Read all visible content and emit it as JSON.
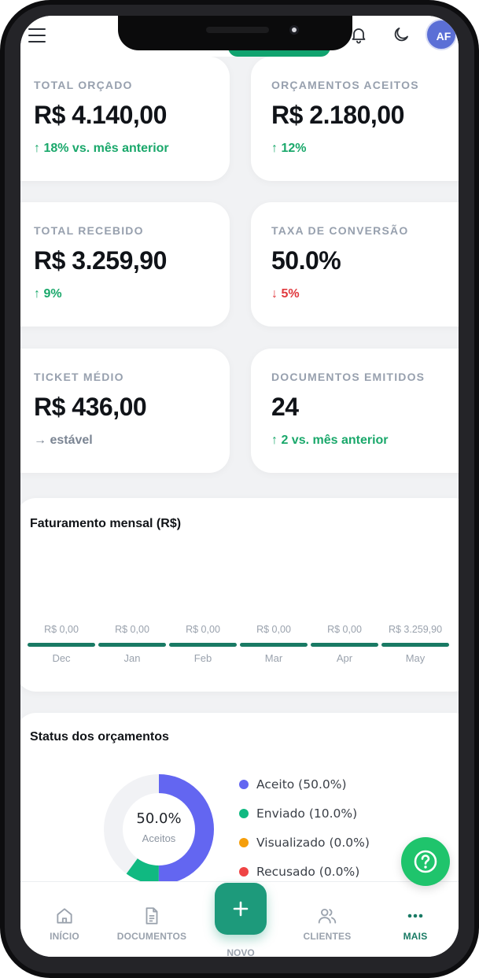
{
  "topbar": {
    "avatar_initials": "AF"
  },
  "stats": [
    {
      "label": "TOTAL ORÇADO",
      "value": "R$ 4.140,00",
      "delta": "↑ 18% vs. mês anterior",
      "trend": "up"
    },
    {
      "label": "ORÇAMENTOS ACEITOS",
      "value": "R$ 2.180,00",
      "delta": "↑ 12%",
      "trend": "up"
    },
    {
      "label": "TOTAL RECEBIDO",
      "value": "R$ 3.259,90",
      "delta": "↑ 9%",
      "trend": "up"
    },
    {
      "label": "TAXA DE CONVERSÃO",
      "value": "50.0%",
      "delta": "↓ 5%",
      "trend": "down"
    },
    {
      "label": "TICKET MÉDIO",
      "value": "R$ 436,00",
      "delta": "→ estável",
      "trend": "flat"
    },
    {
      "label": "DOCUMENTOS EMITIDOS",
      "value": "24",
      "delta": "↑ 2 vs. mês anterior",
      "trend": "up"
    }
  ],
  "revenue": {
    "title": "Faturamento mensal (R$)",
    "months": [
      {
        "label": "Dec",
        "value_text": "R$ 0,00"
      },
      {
        "label": "Jan",
        "value_text": "R$ 0,00"
      },
      {
        "label": "Feb",
        "value_text": "R$ 0,00"
      },
      {
        "label": "Mar",
        "value_text": "R$ 0,00"
      },
      {
        "label": "Apr",
        "value_text": "R$ 0,00"
      },
      {
        "label": "May",
        "value_text": "R$ 3.259,90"
      }
    ]
  },
  "chart_data": [
    {
      "type": "bar",
      "title": "Faturamento mensal (R$)",
      "categories": [
        "Dec",
        "Jan",
        "Feb",
        "Mar",
        "Apr",
        "May"
      ],
      "values": [
        0,
        0,
        0,
        0,
        0,
        3259.9
      ]
    },
    {
      "type": "pie",
      "title": "Status dos orçamentos",
      "categories": [
        "Aceito",
        "Enviado",
        "Visualizado",
        "Recusado"
      ],
      "values": [
        50.0,
        10.0,
        0.0,
        0.0
      ]
    }
  ],
  "status": {
    "title": "Status dos orçamentos",
    "center_value": "50.0%",
    "center_label": "Aceitos",
    "legend": [
      {
        "label": "Aceito (50.0%)",
        "color": "#6366f1"
      },
      {
        "label": "Enviado (10.0%)",
        "color": "#10b981"
      },
      {
        "label": "Visualizado (0.0%)",
        "color": "#f59e0b"
      },
      {
        "label": "Recusado (0.0%)",
        "color": "#ef4444"
      }
    ]
  },
  "nav": {
    "inicio": "INÍCIO",
    "documentos": "DOCUMENTOS",
    "novo": "NOVO",
    "clientes": "CLIENTES",
    "mais": "MAIS",
    "active_color": "#197a64"
  },
  "icons": {
    "menu": "hamburger-menu-icon",
    "notifications": "bell-icon",
    "theme": "moon-icon",
    "help": "question-circle-icon",
    "home": "home-icon",
    "documents": "document-icon",
    "add": "plus-icon",
    "clients": "users-icon",
    "more": "dots-icon"
  }
}
